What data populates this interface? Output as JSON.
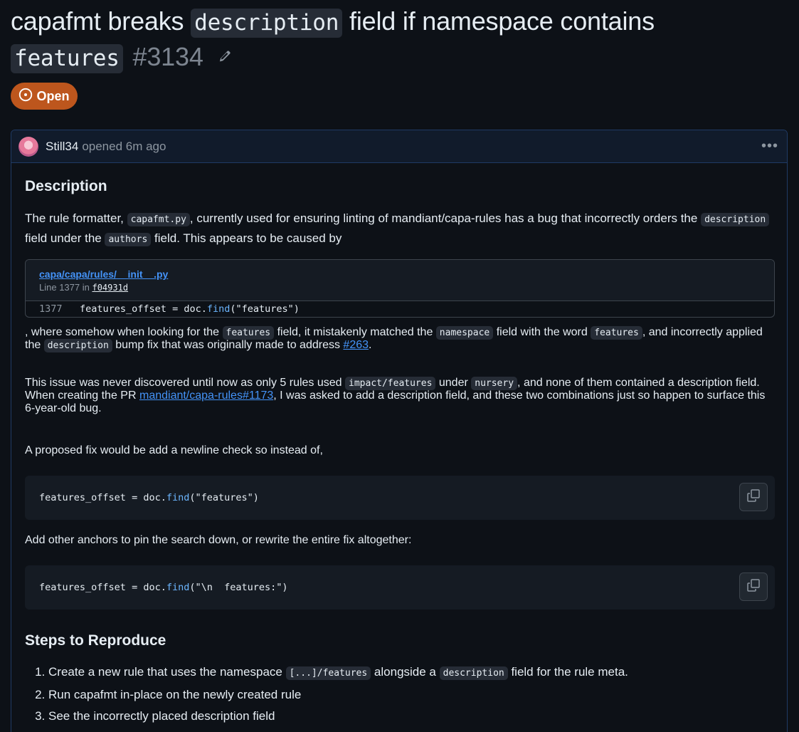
{
  "issue": {
    "title_part1": "capafmt breaks",
    "title_code1": "description",
    "title_part2": "field if namespace contains",
    "title_code2": "features",
    "number": "#3134",
    "state": "Open"
  },
  "comment": {
    "author": "Still34",
    "opened_text": "opened 6m ago",
    "heading_description": "Description",
    "p1": {
      "t1": "The rule formatter,",
      "c1": "capafmt.py",
      "t2": ", currently used for ensuring linting of mandiant/capa-rules has a bug that incorrectly orders the",
      "c2": "description",
      "t3": "field under the",
      "c3": "authors",
      "t4": "field. This appears to be caused by"
    },
    "permalink": {
      "file": "capa/capa/rules/__init__.py",
      "line_label": "Line 1377 in",
      "sha": "f04931d",
      "line_number": "1377",
      "code_var": "features_offset",
      "code_eq": "=",
      "code_obj": "doc.",
      "code_fn": "find",
      "code_args": "(\"features\")"
    },
    "p2": {
      "t1": ", where somehow when looking for the",
      "c1": "features",
      "t2": "field, it mistakenly matched the",
      "c2": "namespace",
      "t3": "field with the word",
      "c3": "features",
      "t4": ", and incorrectly applied the",
      "c4": "description",
      "t5": "bump fix that was originally made to address",
      "link": "#263",
      "t6": "."
    },
    "p3": {
      "t1": "This issue was never discovered until now as only 5 rules used",
      "c1": "impact/features",
      "t2": "under",
      "c2": "nursery",
      "t3": ", and none of them contained a description field. When creating the PR",
      "link": "mandiant/capa-rules#1173",
      "t4": ", I was asked to add a description field, and these two combinations just so happen to surface this 6-year-old bug."
    },
    "p4": "A proposed fix would be add a newline check so instead of,",
    "code1": {
      "var": "features_offset",
      "eq": "=",
      "obj": "doc.",
      "fn": "find",
      "args": "(\"features\")"
    },
    "p5": "Add other anchors to pin the search down, or rewrite the entire fix altogether:",
    "code2": {
      "var": "features_offset",
      "eq": "=",
      "obj": "doc.",
      "fn": "find",
      "args": "(\"\\n  features:\")"
    },
    "heading_steps": "Steps to Reproduce",
    "steps": {
      "s1_t1": "Create a new rule that uses the namespace",
      "s1_c1": "[...]/features",
      "s1_t2": "alongside a",
      "s1_c2": "description",
      "s1_t3": "field for the rule meta.",
      "s2": "Run capafmt in-place on the newly created rule",
      "s3": "See the incorrectly placed description field"
    }
  },
  "colors": {
    "background": "#0d1117",
    "open_badge": "#bd561d",
    "link": "#4493f8",
    "muted": "#8d96a0",
    "comment_border": "#1f3a64"
  },
  "icons": [
    "issue-opened-icon",
    "pencil-icon",
    "kebab-menu-icon",
    "copy-icon"
  ]
}
